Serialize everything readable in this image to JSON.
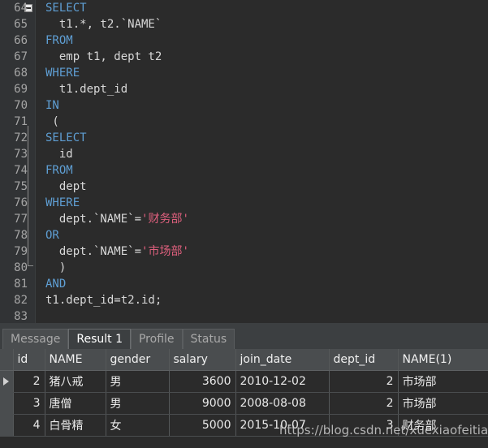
{
  "editor": {
    "first_line_number": 64,
    "fold_marker_line": 71,
    "lines": [
      {
        "n": "64",
        "tokens": [
          {
            "t": "SELECT",
            "c": "kw"
          }
        ]
      },
      {
        "n": "65",
        "tokens": [
          {
            "t": "  t1.*, t2.`NAME`",
            "c": "plain"
          }
        ]
      },
      {
        "n": "66",
        "tokens": [
          {
            "t": "FROM",
            "c": "kw"
          }
        ]
      },
      {
        "n": "67",
        "tokens": [
          {
            "t": "  emp t1, dept t2",
            "c": "plain"
          }
        ]
      },
      {
        "n": "68",
        "tokens": [
          {
            "t": "WHERE",
            "c": "kw"
          }
        ]
      },
      {
        "n": "69",
        "tokens": [
          {
            "t": "  t1.dept_id",
            "c": "plain"
          }
        ]
      },
      {
        "n": "70",
        "tokens": [
          {
            "t": "IN",
            "c": "kw"
          }
        ]
      },
      {
        "n": "71",
        "tokens": [
          {
            "t": " (",
            "c": "plain"
          }
        ]
      },
      {
        "n": "72",
        "tokens": [
          {
            "t": "SELECT",
            "c": "kw"
          }
        ]
      },
      {
        "n": "73",
        "tokens": [
          {
            "t": "  id",
            "c": "plain"
          }
        ]
      },
      {
        "n": "74",
        "tokens": [
          {
            "t": "FROM",
            "c": "kw"
          }
        ]
      },
      {
        "n": "75",
        "tokens": [
          {
            "t": "  dept",
            "c": "plain"
          }
        ]
      },
      {
        "n": "76",
        "tokens": [
          {
            "t": "WHERE",
            "c": "kw"
          }
        ]
      },
      {
        "n": "77",
        "tokens": [
          {
            "t": "  dept.`NAME`=",
            "c": "plain"
          },
          {
            "t": "'财务部'",
            "c": "str"
          }
        ]
      },
      {
        "n": "78",
        "tokens": [
          {
            "t": "OR",
            "c": "kw"
          }
        ]
      },
      {
        "n": "79",
        "tokens": [
          {
            "t": "  dept.`NAME`=",
            "c": "plain"
          },
          {
            "t": "'市场部'",
            "c": "str"
          }
        ]
      },
      {
        "n": "80",
        "tokens": [
          {
            "t": "  )",
            "c": "plain"
          }
        ]
      },
      {
        "n": "81",
        "tokens": [
          {
            "t": "AND",
            "c": "kw"
          }
        ]
      },
      {
        "n": "82",
        "tokens": [
          {
            "t": "t1.dept_id=t2.id;",
            "c": "plain"
          }
        ]
      },
      {
        "n": "83",
        "tokens": [
          {
            "t": "",
            "c": "plain"
          }
        ]
      }
    ],
    "colors": {
      "background": "#2b2b2b",
      "gutter": "#313335",
      "keyword": "#5f9fd4",
      "string": "#e0607e",
      "text": "#d8d8d8",
      "line_number": "#a5a5a5"
    }
  },
  "tabs": [
    {
      "label": "Message",
      "active": false
    },
    {
      "label": "Result 1",
      "active": true
    },
    {
      "label": "Profile",
      "active": false
    },
    {
      "label": "Status",
      "active": false
    }
  ],
  "result_grid": {
    "columns": [
      "id",
      "NAME",
      "gender",
      "salary",
      "join_date",
      "dept_id",
      "NAME(1)"
    ],
    "rows": [
      {
        "selected": true,
        "cells": [
          "2",
          "猪八戒",
          "男",
          "3600",
          "2010-12-02",
          "2",
          "市场部"
        ]
      },
      {
        "selected": false,
        "cells": [
          "3",
          "唐僧",
          "男",
          "9000",
          "2008-08-08",
          "2",
          "市场部"
        ]
      },
      {
        "selected": false,
        "cells": [
          "4",
          "白骨精",
          "女",
          "5000",
          "2015-10-07",
          "3",
          "财务部"
        ]
      }
    ]
  },
  "watermark": {
    "text": "https://blog.csdn.net/xuexiaofeitian"
  }
}
